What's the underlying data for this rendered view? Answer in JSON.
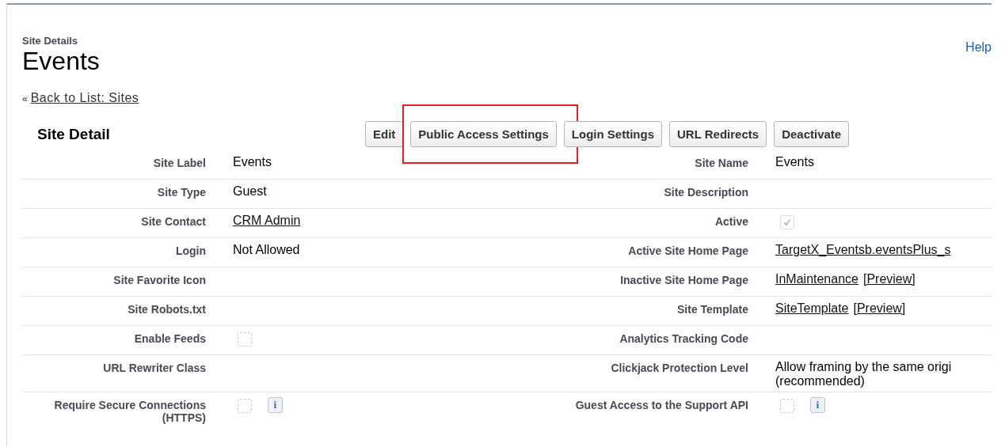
{
  "header": {
    "subtitle": "Site Details",
    "title": "Events",
    "help_link": "Help"
  },
  "back_link": {
    "prefix": "«",
    "label": "Back to List: Sites"
  },
  "section": {
    "title": "Site Detail"
  },
  "buttons": [
    {
      "label": "Edit",
      "highlighted": false
    },
    {
      "label": "Public Access Settings",
      "highlighted": true
    },
    {
      "label": "Login Settings",
      "highlighted": false
    },
    {
      "label": "URL Redirects",
      "highlighted": false
    },
    {
      "label": "Deactivate",
      "highlighted": false
    }
  ],
  "rows": [
    {
      "left": {
        "label": "Site Label",
        "kind": "text",
        "value": "Events"
      },
      "right": {
        "label": "Site Name",
        "kind": "text",
        "value": "Events"
      }
    },
    {
      "left": {
        "label": "Site Type",
        "kind": "text",
        "value": "Guest"
      },
      "right": {
        "label": "Site Description",
        "kind": "empty"
      }
    },
    {
      "left": {
        "label": "Site Contact",
        "kind": "link",
        "value": "CRM Admin"
      },
      "right": {
        "label": "Active",
        "kind": "checkbox",
        "checked": true
      }
    },
    {
      "left": {
        "label": "Login",
        "kind": "text",
        "value": "Not Allowed"
      },
      "right": {
        "label": "Active Site Home Page",
        "kind": "link",
        "value": "TargetX_Eventsb.eventsPlus_s"
      }
    },
    {
      "left": {
        "label": "Site Favorite Icon",
        "kind": "empty"
      },
      "right": {
        "label": "Inactive Site Home Page",
        "kind": "link_preview",
        "value": "InMaintenance",
        "preview": "[Preview]"
      }
    },
    {
      "left": {
        "label": "Site Robots.txt",
        "kind": "empty"
      },
      "right": {
        "label": "Site Template",
        "kind": "link_preview",
        "value": "SiteTemplate",
        "preview": "[Preview]"
      }
    },
    {
      "left": {
        "label": "Enable Feeds",
        "kind": "checkbox",
        "checked": false
      },
      "right": {
        "label": "Analytics Tracking Code",
        "kind": "empty"
      }
    },
    {
      "left": {
        "label": "URL Rewriter Class",
        "kind": "empty"
      },
      "right": {
        "label": "Clickjack Protection Level",
        "kind": "text",
        "value": "Allow framing by the same origi (recommended)"
      }
    },
    {
      "left": {
        "label": "Require Secure Connections (HTTPS)",
        "kind": "checkbox_info",
        "checked": false,
        "info": "i"
      },
      "right": {
        "label": "Guest Access to the Support API",
        "kind": "checkbox_info",
        "checked": false,
        "info": "i"
      }
    }
  ]
}
